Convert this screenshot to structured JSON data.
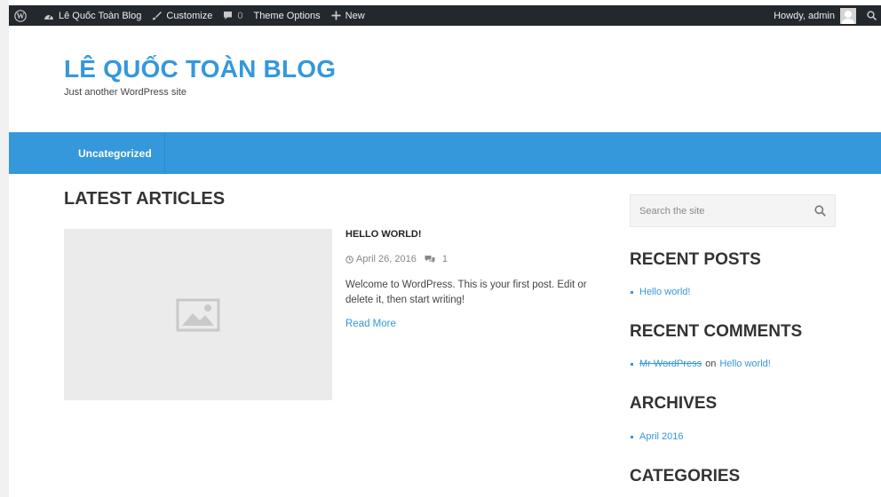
{
  "admin_bar": {
    "site_name": "Lê Quốc Toàn Blog",
    "customize": "Customize",
    "comments_count": "0",
    "theme_options": "Theme Options",
    "new": "New",
    "greeting": "Howdy, admin"
  },
  "header": {
    "site_title": "LÊ QUỐC TOÀN BLOG",
    "tagline": "Just another WordPress site"
  },
  "nav": {
    "items": [
      {
        "label": "Uncategorized"
      }
    ]
  },
  "main": {
    "section_title": "LATEST ARTICLES",
    "post": {
      "title": "HELLO WORLD!",
      "date": "April 26, 2016",
      "comments": "1",
      "excerpt": "Welcome to WordPress. This is your first post. Edit or delete it, then start writing!",
      "read_more": "Read More"
    }
  },
  "sidebar": {
    "search_placeholder": "Search the site",
    "recent_posts": {
      "title": "RECENT POSTS",
      "items": [
        "Hello world!"
      ]
    },
    "recent_comments": {
      "title": "RECENT COMMENTS",
      "author": "Mr WordPress",
      "on": "on",
      "post": "Hello world!"
    },
    "archives": {
      "title": "ARCHIVES",
      "items": [
        "April 2016"
      ]
    },
    "categories": {
      "title": "CATEGORIES"
    }
  },
  "colors": {
    "accent": "#3498db",
    "admin_bar": "#23282d"
  }
}
